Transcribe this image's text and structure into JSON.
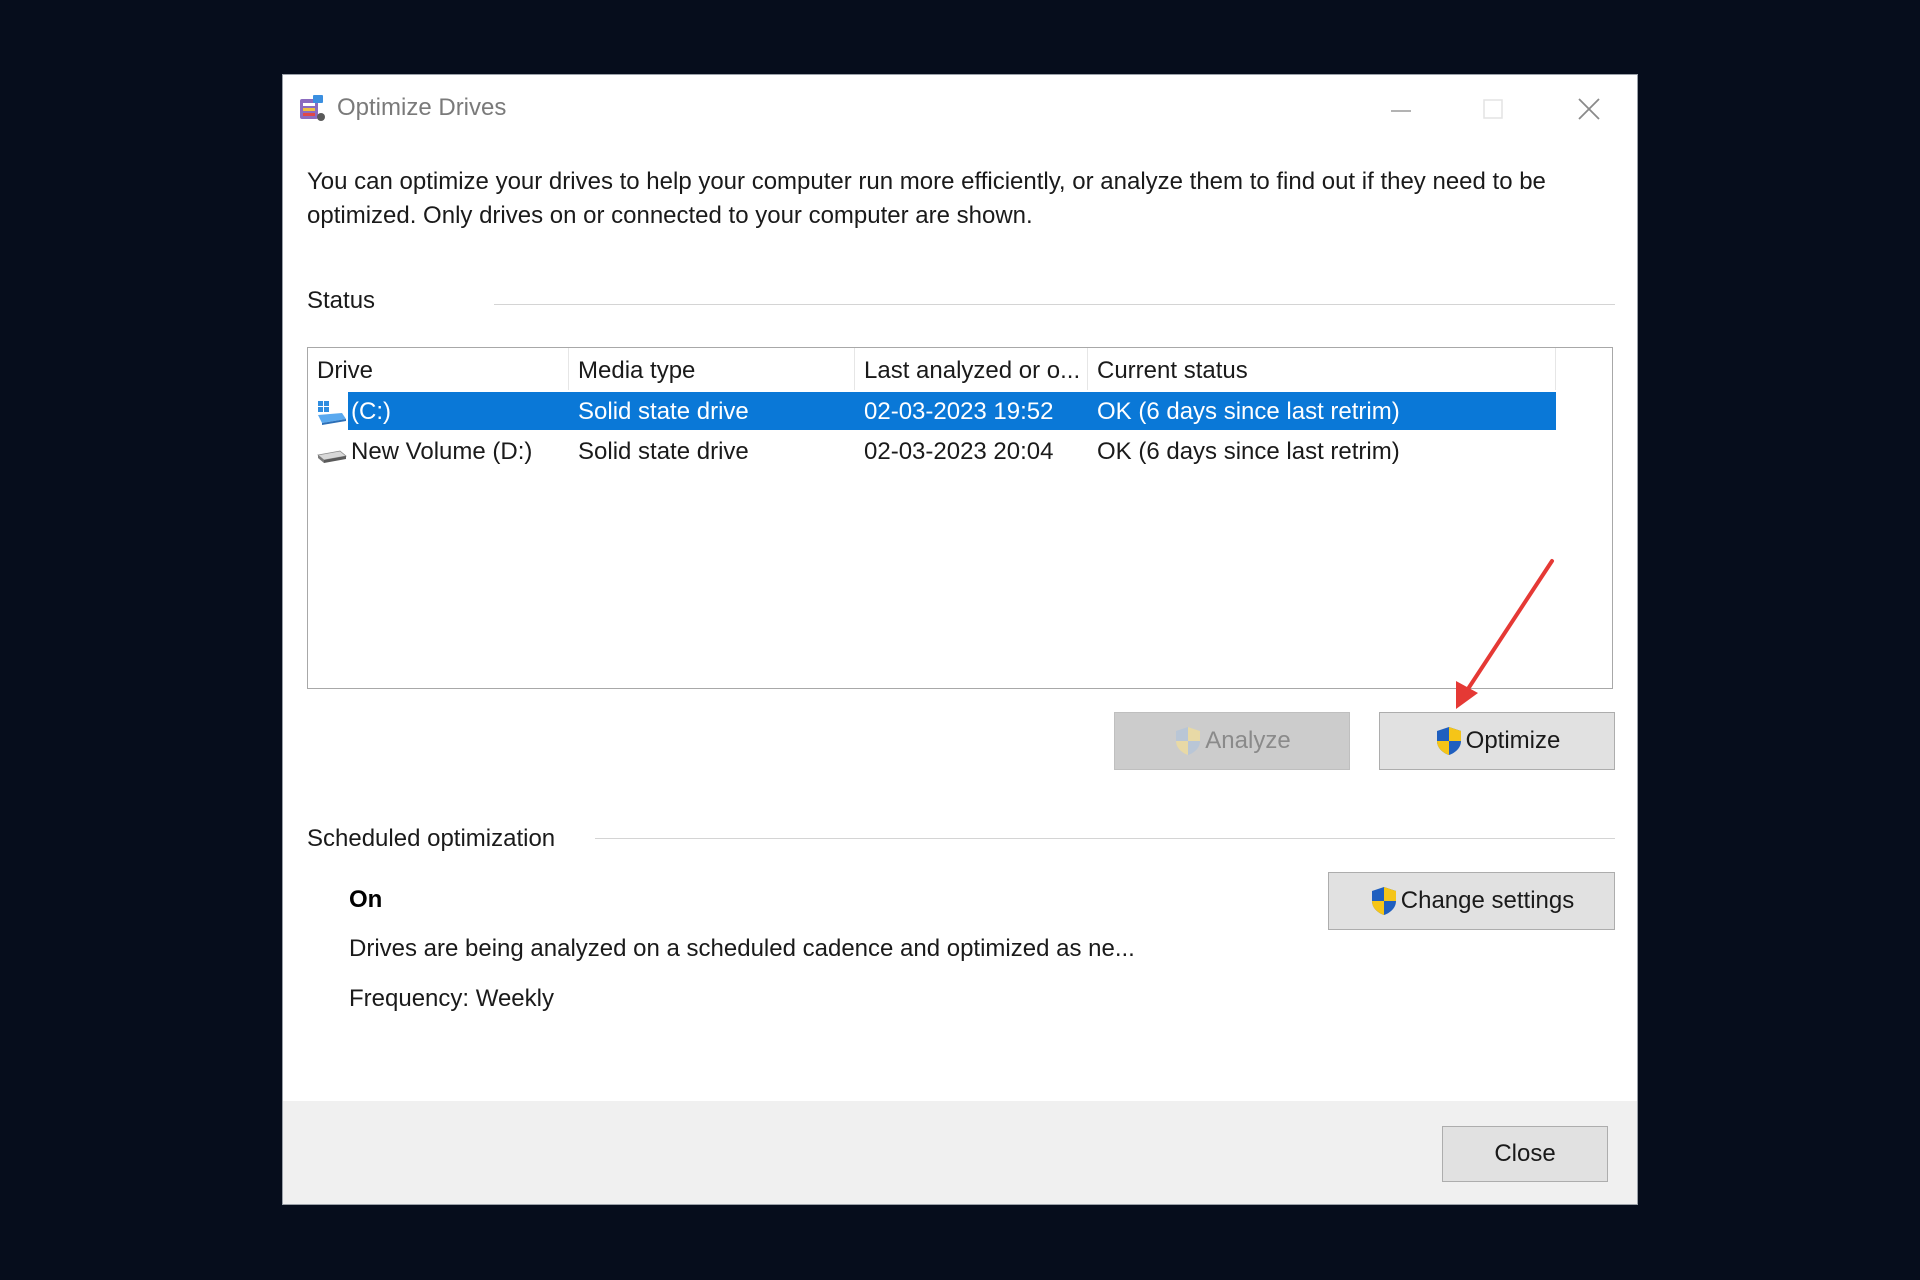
{
  "window": {
    "title": "Optimize Drives"
  },
  "description": "You can optimize your drives to help your computer run more efficiently, or analyze them to find out if they need to be optimized. Only drives on or connected to your computer are shown.",
  "status": {
    "label": "Status",
    "columns": [
      "Drive",
      "Media type",
      "Last analyzed or o...",
      "Current status"
    ],
    "rows": [
      {
        "drive": "(C:)",
        "media": "Solid state drive",
        "last": "02-03-2023 19:52",
        "status": "OK (6 days since last retrim)",
        "icon": "windows-drive-icon",
        "selected": true
      },
      {
        "drive": "New Volume (D:)",
        "media": "Solid state drive",
        "last": "02-03-2023 20:04",
        "status": "OK (6 days since last retrim)",
        "icon": "drive-icon",
        "selected": false
      }
    ]
  },
  "buttons": {
    "analyze": "Analyze",
    "optimize": "Optimize",
    "change_settings": "Change settings",
    "close": "Close"
  },
  "scheduled": {
    "label": "Scheduled optimization",
    "state": "On",
    "description": "Drives are being analyzed on a scheduled cadence and optimized as ne...",
    "frequency": "Frequency: Weekly"
  },
  "colors": {
    "selection": "#0a78d7",
    "annotation_arrow": "#e53935",
    "shield_blue": "#1f5fbf",
    "shield_yellow": "#f5c518"
  }
}
